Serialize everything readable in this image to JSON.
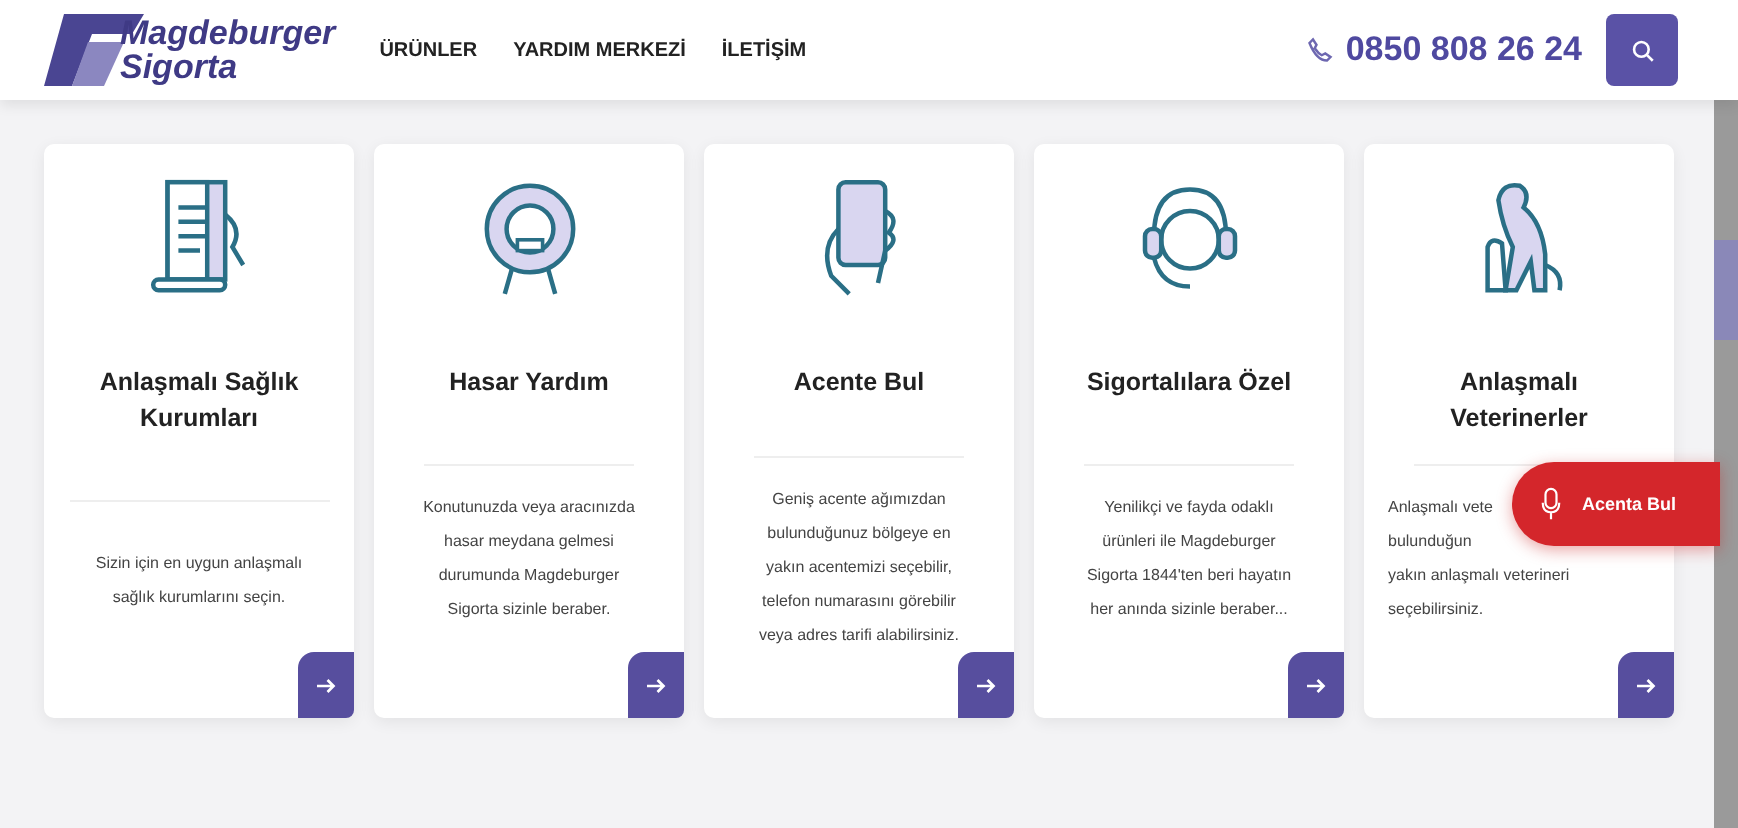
{
  "header": {
    "logo": {
      "line1": "Magdeburger",
      "line2": "Sigorta"
    },
    "nav": [
      "ÜRÜNLER",
      "YARDIM MERKEZİ",
      "İLETİŞİM"
    ],
    "phone": "0850 808 26 24"
  },
  "cards": [
    {
      "title": "Anlaşmalı Sağlık Kurumları",
      "description": "Sizin için en uygun anlaşmalı\nsağlık kurumlarını seçin."
    },
    {
      "title": "Hasar Yardım",
      "description": "Konutunuzda veya aracınızda\nhasar meydana gelmesi\ndurumunda Magdeburger\nSigorta sizinle beraber."
    },
    {
      "title": "Acente Bul",
      "description": "Geniş acente ağımızdan\nbulunduğunuz bölgeye en\nyakın acentemizi seçebilir,\ntelefon numarasını görebilir\nveya adres tarifi alabilirsiniz."
    },
    {
      "title": "Sigortalılara Özel",
      "description": "Yenilikçi ve fayda odaklı\nürünleri ile Magdeburger\nSigorta 1844'ten beri hayatın\nher anında sizinle beraber..."
    },
    {
      "title": "Anlaşmalı Veterinerler",
      "description": "Anlaşmalı vete\nbulunduğun\nyakın anlaşmalı veterineri\nseçebilirsiniz."
    }
  ],
  "floating_button": {
    "label": "Acenta Bul"
  }
}
